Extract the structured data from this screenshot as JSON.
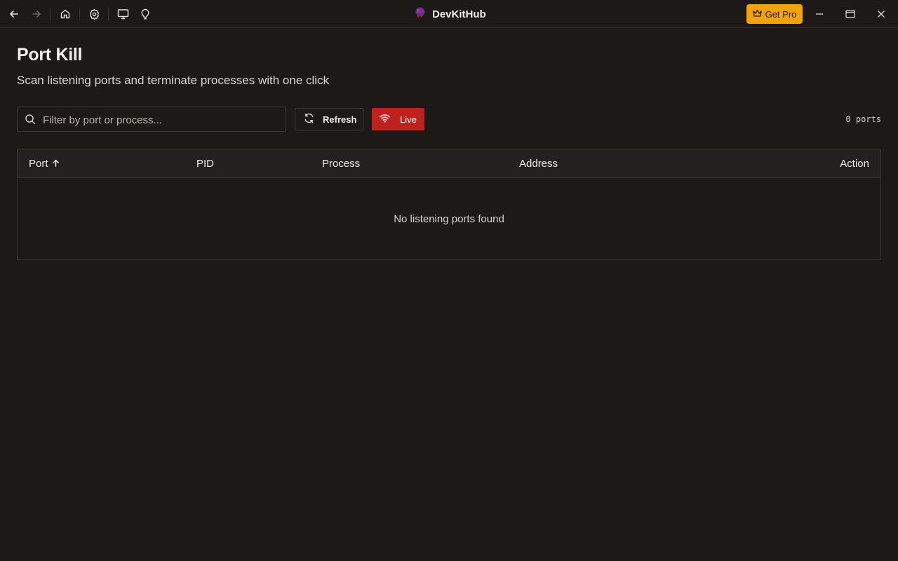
{
  "titlebar": {
    "app_name": "DevKitHub",
    "get_pro_label": "Get Pro",
    "nav_icons": [
      "arrow-left-icon",
      "arrow-right-icon",
      "home-icon",
      "gear-icon",
      "monitor-icon",
      "lightbulb-icon"
    ],
    "window_icons": [
      "minimize-icon",
      "maximize-icon",
      "close-icon"
    ]
  },
  "page": {
    "title": "Port Kill",
    "subtitle": "Scan listening ports and terminate processes with one click"
  },
  "toolbar": {
    "search_placeholder": "Filter by port or process...",
    "search_value": "",
    "refresh_label": "Refresh",
    "live_label": "Live",
    "port_count": "0 ports"
  },
  "table": {
    "columns": [
      {
        "label": "Port",
        "sort": "asc"
      },
      {
        "label": "PID"
      },
      {
        "label": "Process"
      },
      {
        "label": "Address"
      },
      {
        "label": "Action"
      }
    ],
    "rows": [],
    "empty_message": "No listening ports found"
  },
  "colors": {
    "background": "#1d1917",
    "accent_pro": "#f4a20b",
    "live_red": "#c0211f"
  }
}
